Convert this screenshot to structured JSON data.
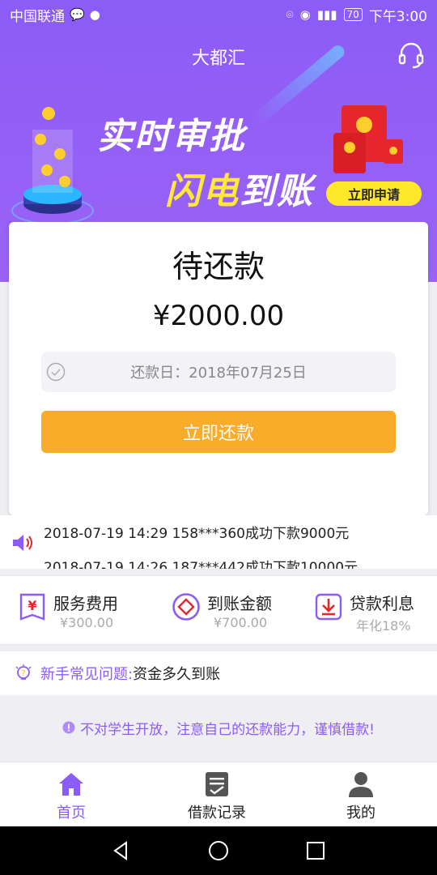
{
  "status_bar": {
    "carrier": "中国联通",
    "battery": "70",
    "time": "下午3:00"
  },
  "header": {
    "title": "大都汇"
  },
  "banner": {
    "line1": "实时审批",
    "line2_a": "闪电",
    "line2_b": "到账",
    "apply_label": "立即申请"
  },
  "repay_card": {
    "title": "待还款",
    "amount": "¥2000.00",
    "due_date_text": "还款日：2018年07月25日",
    "button_label": "立即还款"
  },
  "ticker": {
    "items": [
      "2018-07-19 14:29 158***360成功下款9000元",
      "2018-07-19 14:26 187***442成功下款10000元"
    ]
  },
  "fees": [
    {
      "name": "服务费用",
      "value": "¥300.00",
      "icon": "receipt-yen-icon"
    },
    {
      "name": "到账金额",
      "value": "¥700.00",
      "icon": "diamond-circle-icon"
    },
    {
      "name": "贷款利息",
      "value": "年化18%",
      "icon": "download-box-icon"
    }
  ],
  "faq": {
    "label": "新手常见问题:",
    "question": " 资金多久到账"
  },
  "notice": {
    "text": "不对学生开放，注意自己的还款能力，谨慎借款!"
  },
  "tabs": [
    {
      "label": "首页",
      "icon": "home-icon",
      "active": true
    },
    {
      "label": "借款记录",
      "icon": "record-icon",
      "active": false
    },
    {
      "label": "我的",
      "icon": "user-icon",
      "active": false
    }
  ],
  "colors": {
    "primary": "#8c5cf6",
    "button_orange": "#f9ab2a",
    "apply_yellow": "#ffe829"
  }
}
